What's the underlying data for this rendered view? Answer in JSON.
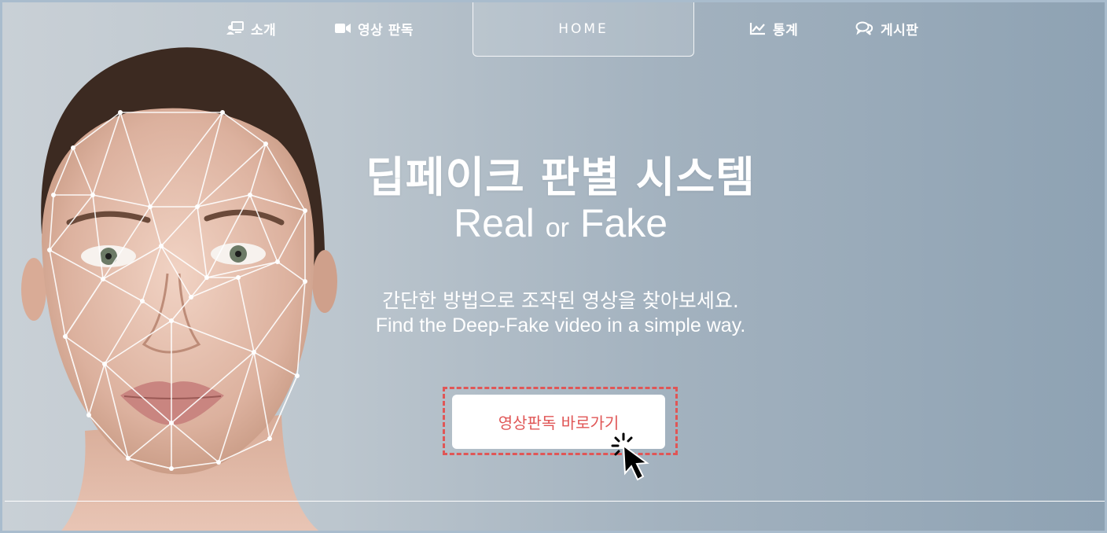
{
  "nav": {
    "items": [
      {
        "label": "소개",
        "icon": "person-board-icon"
      },
      {
        "label": "영상 판독",
        "icon": "video-camera-icon"
      },
      {
        "label": "HOME",
        "icon": ""
      },
      {
        "label": "통계",
        "icon": "line-chart-icon"
      },
      {
        "label": "게시판",
        "icon": "chat-bubbles-icon"
      }
    ]
  },
  "hero": {
    "title": "딥페이크 판별 시스템",
    "subtitle_real": "Real",
    "subtitle_or": "or",
    "subtitle_fake": "Fake",
    "desc_ko": "간단한 방법으로 조작된 영상을 찾아보세요.",
    "desc_en": "Find the Deep-Fake video in a simple way.",
    "cta_label": "영상판독 바로가기"
  },
  "colors": {
    "accent": "#e05656",
    "background_left": "#c9d0d6",
    "background_right": "#8ea2b3",
    "text": "#ffffff"
  }
}
